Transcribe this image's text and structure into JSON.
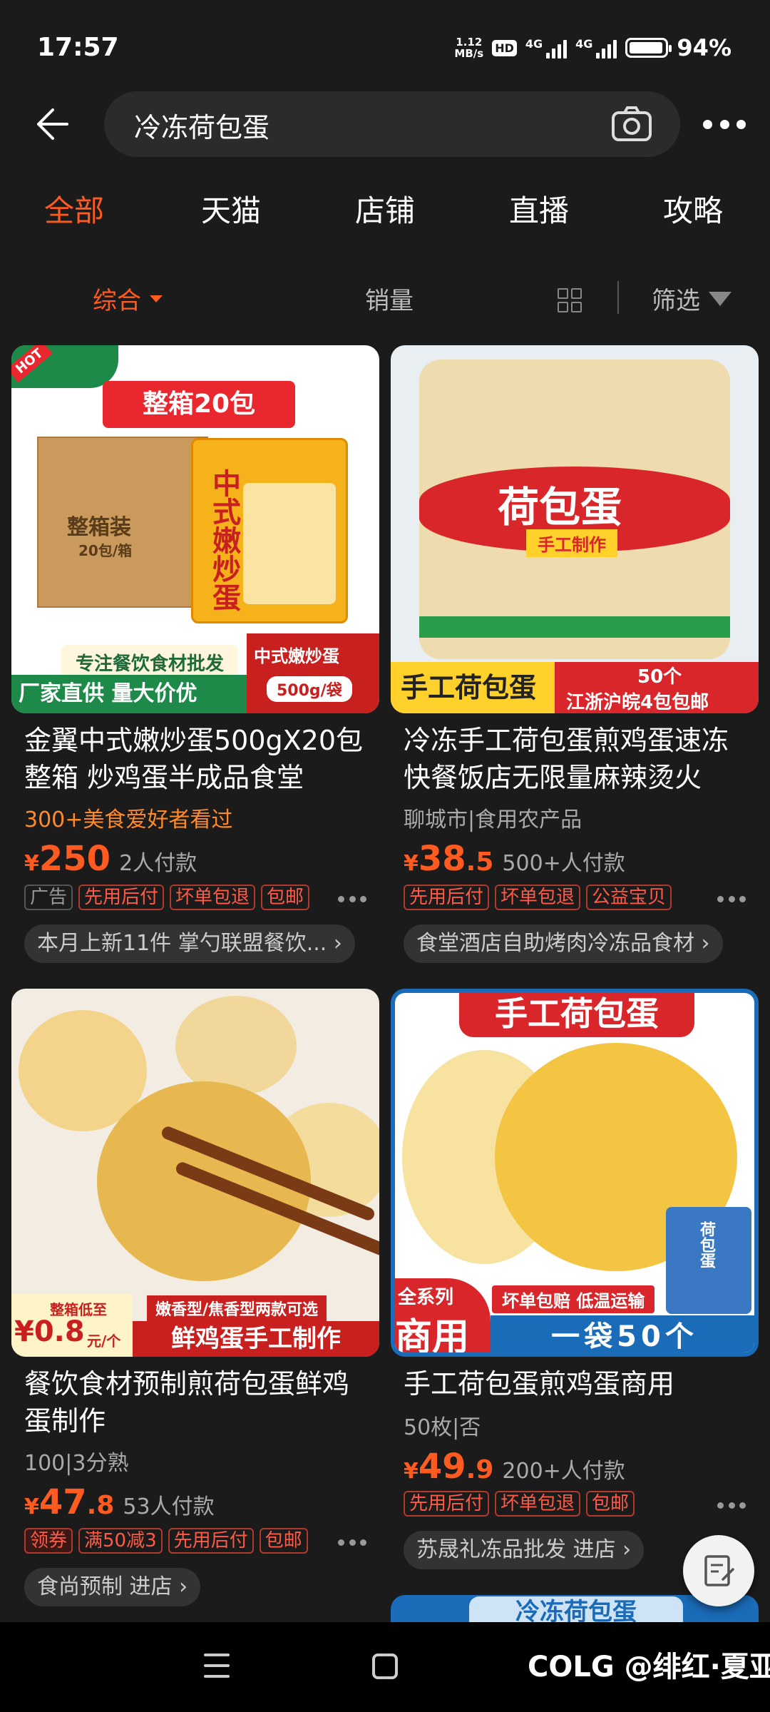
{
  "status": {
    "time": "17:57",
    "net_speed_top": "1.12",
    "net_speed_bottom": "MB/s",
    "hd": "HD",
    "sim1": "4G",
    "sim2": "4G",
    "battery": "94%",
    "battery_level": 0.94
  },
  "search": {
    "query": "冷冻荷包蛋",
    "back_icon": "back-arrow-icon",
    "camera_icon": "camera-icon",
    "more_icon": "more-dots-icon"
  },
  "tabs": [
    "全部",
    "天猫",
    "店铺",
    "直播",
    "攻略"
  ],
  "sort": {
    "default": "综合",
    "sales": "销量",
    "filter": "筛选"
  },
  "products": [
    {
      "title": "金翼中式嫩炒蛋500gX20包整箱 炒鸡蛋半成品食堂",
      "sub": "300+美食爱好者看过",
      "price_int": "250",
      "price_dec": "",
      "buyers": "2人付款",
      "tags": [
        "广告",
        "先用后付",
        "坏单包退",
        "包邮"
      ],
      "shop": "本月上新11件 掌勺联盟餐饮...",
      "img": {
        "corner": "HOT",
        "banner": "整箱20包",
        "box_label": "整箱装",
        "box_sub": "20包/箱",
        "bag_text": "中式嫩炒蛋",
        "strip1": "专注餐饮食材批发",
        "strip2": "厂家直供  量大价优",
        "spec_title": "中式嫩炒蛋",
        "spec": "500g/袋"
      }
    },
    {
      "title": "冷冻手工荷包蛋煎鸡蛋速冻快餐饭店无限量麻辣烫火",
      "sub": "聊城市|食用农产品",
      "price_int": "38",
      "price_dec": ".5",
      "buyers": "500+人付款",
      "tags": [
        "先用后付",
        "坏单包退",
        "公益宝贝"
      ],
      "shop": "食堂酒店自助烤肉冷冻品食材",
      "img": {
        "bag_title": "荷包蛋",
        "bag_sub": "手工制作",
        "bottom_left": "手工荷包蛋",
        "bottom_r1": "50个",
        "bottom_r2": "江浙沪皖4包包邮"
      }
    },
    {
      "title": "餐饮食材预制煎荷包蛋鲜鸡蛋制作",
      "sub": "100|3分熟",
      "price_int": "47",
      "price_dec": ".8",
      "buyers": "53人付款",
      "tags": [
        "领券",
        "满50减3",
        "先用后付",
        "包邮"
      ],
      "shop": "食尚预制 进店",
      "img": {
        "low_label": "整箱低至",
        "low_price": "¥0.8",
        "low_unit": "元/个",
        "line1": "嫩香型/焦香型两款可选",
        "line2": "鲜鸡蛋手工制作"
      }
    },
    {
      "title": "手工荷包蛋煎鸡蛋商用",
      "sub": "50枚|否",
      "price_int": "49",
      "price_dec": ".9",
      "buyers": "200+人付款",
      "tags": [
        "先用后付",
        "坏单包退",
        "包邮"
      ],
      "shop": "苏晟礼冻品批发 进店",
      "img": {
        "top_banner": "手工荷包蛋",
        "series_top": "全系列",
        "series_big": "商用",
        "promise": "坏单包赔  低温运输",
        "count": "一袋50个",
        "bag": "荷包蛋"
      }
    }
  ],
  "next_card_banner": "冷冻荷包蛋",
  "nav": {
    "watermark": "@绯红·夏亚",
    "watermark_logo": "COLG"
  }
}
